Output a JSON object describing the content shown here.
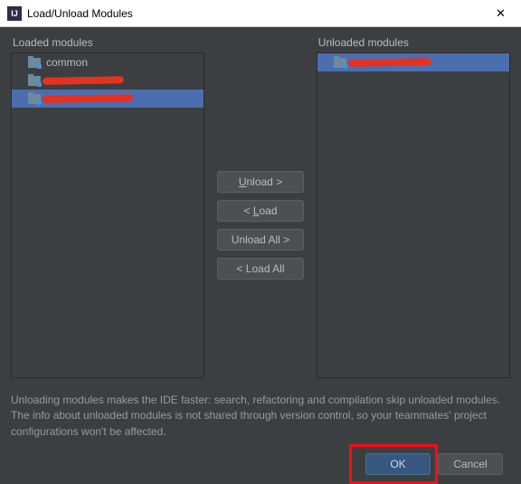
{
  "title": "Load/Unload Modules",
  "labels": {
    "loaded": "Loaded modules",
    "unloaded": "Unloaded modules"
  },
  "loaded_items": [
    {
      "name": "common",
      "redacted": false
    },
    {
      "name": "common ws",
      "redacted": true
    },
    {
      "name": "pacific servic",
      "redacted": true
    }
  ],
  "unloaded_items": [
    {
      "name": "singer servic",
      "redacted": true
    }
  ],
  "buttons": {
    "unload": "Unload >",
    "load": "< Load",
    "unload_all": "Unload All >",
    "load_all": "< Load All",
    "ok": "OK",
    "cancel": "Cancel"
  },
  "info": "Unloading modules makes the IDE faster: search, refactoring and compilation skip unloaded modules. The info about unloaded modules is not shared through version control, so your teammates' project configurations won't be affected."
}
